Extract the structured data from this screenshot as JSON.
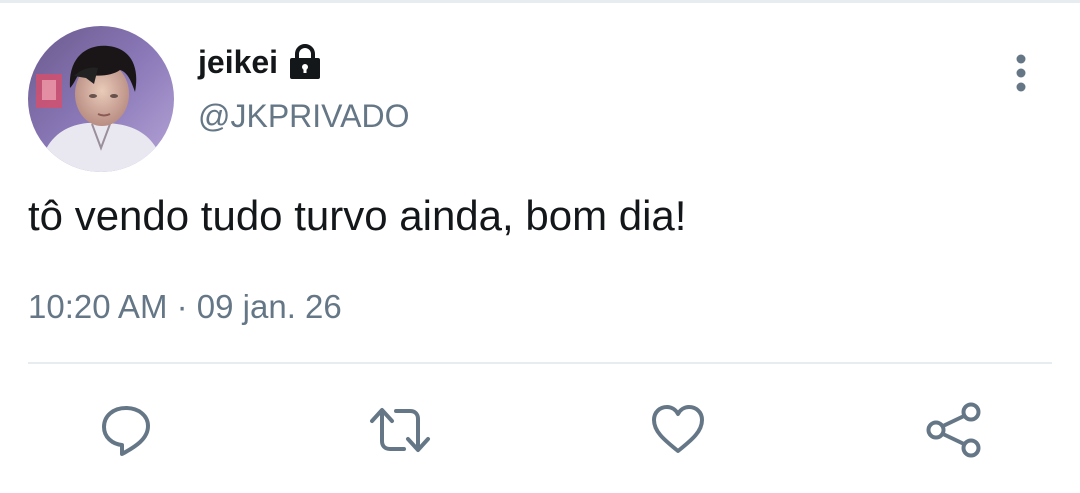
{
  "tweet": {
    "author": {
      "display_name": "jeikei",
      "handle": "@JKPRIVADO",
      "protected": true
    },
    "text": "tô vendo tudo turvo ainda, bom dia!",
    "time": "10:20 AM",
    "separator": "·",
    "date": "09 jan. 26"
  },
  "actions": {
    "reply": "reply-icon",
    "retweet": "retweet-icon",
    "like": "heart-icon",
    "share": "share-icon"
  },
  "colors": {
    "text_primary": "#14171a",
    "text_secondary": "#657786",
    "icon": "#657786",
    "divider": "#e6ecf0"
  }
}
